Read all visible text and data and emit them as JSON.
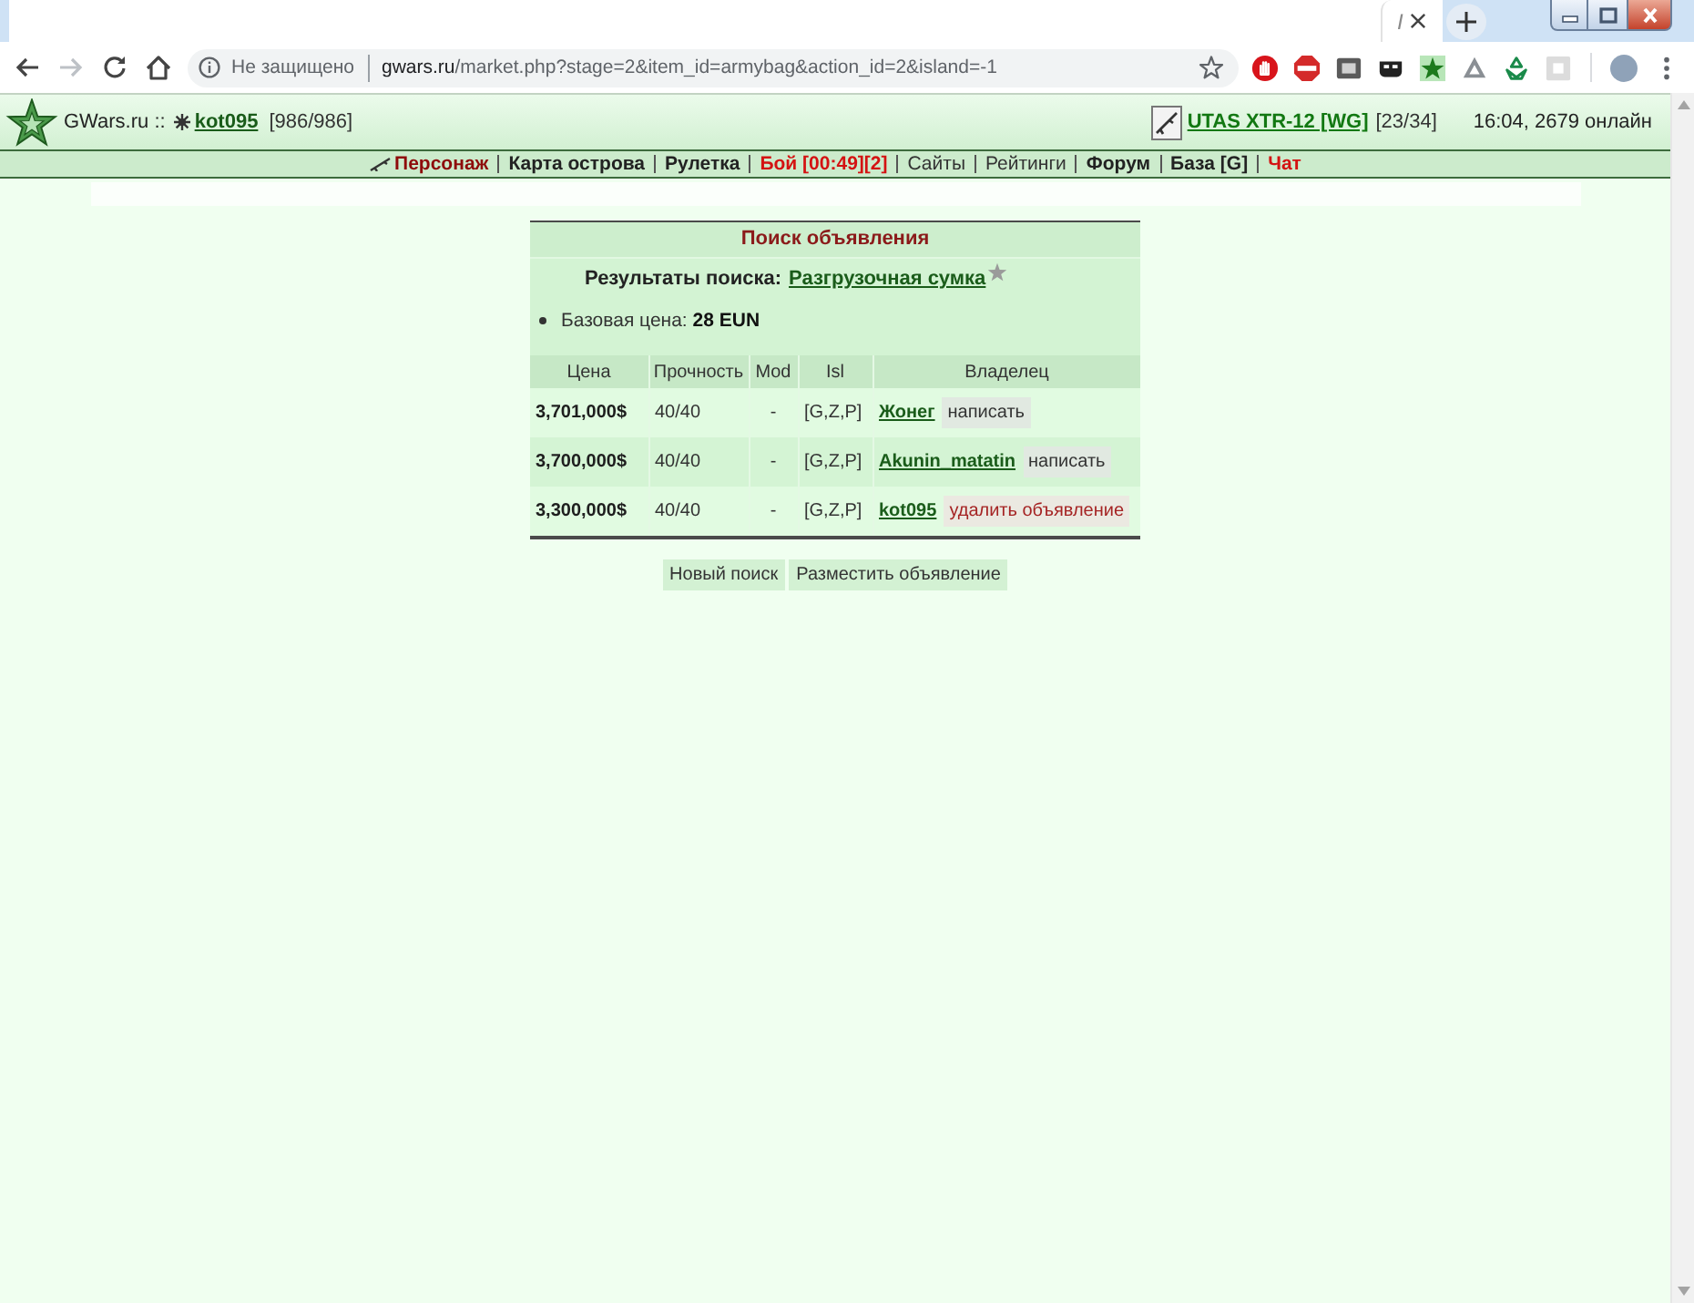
{
  "browser": {
    "tab": {
      "title": "I"
    },
    "address": {
      "security": "Не защищено",
      "host": "gwars.ru",
      "path": "/market.php?stage=2&item_id=armybag&action_id=2&island=-1"
    }
  },
  "header": {
    "site": "GWars.ru ::",
    "user": "kot095",
    "hp": "[986/986]",
    "weapon": "UTAS XTR-12 [WG]",
    "ammo": "[23/34]",
    "status": "16:04, 2679 онлайн"
  },
  "nav": [
    {
      "label": "Персонаж",
      "kind": "accent"
    },
    {
      "label": "Карта острова",
      "kind": "bold"
    },
    {
      "label": "Рулетка",
      "kind": "bold"
    },
    {
      "label": "Бой [00:49][2]",
      "kind": "alert"
    },
    {
      "label": "Сайты",
      "kind": "plain"
    },
    {
      "label": "Рейтинги",
      "kind": "plain"
    },
    {
      "label": "Форум",
      "kind": "bold"
    },
    {
      "label": "База [G]",
      "kind": "bold"
    },
    {
      "label": "Чат",
      "kind": "alert"
    }
  ],
  "search": {
    "title": "Поиск объявления",
    "results_label": "Результаты поиска:",
    "item": "Разгрузочная сумка",
    "base_price": "Базовая цена: **28 EUN**",
    "columns": [
      "Цена",
      "Прочность",
      "Mod",
      "Isl",
      "Владелец"
    ],
    "rows": [
      {
        "price": "3,701,000$",
        "durability": "40/40",
        "mod": "-",
        "islands": "[G,Z,P]",
        "owner": "Жонег",
        "action": {
          "label": "написать",
          "kind": "message"
        }
      },
      {
        "price": "3,700,000$",
        "durability": "40/40",
        "mod": "-",
        "islands": "[G,Z,P]",
        "owner": "Akunin_matatin",
        "action": {
          "label": "написать",
          "kind": "message"
        }
      },
      {
        "price": "3,300,000$",
        "durability": "40/40",
        "mod": "-",
        "islands": "[G,Z,P]",
        "owner": "kot095",
        "action": {
          "label": "удалить объявление",
          "kind": "delete"
        }
      }
    ]
  },
  "buttons": [
    "Новый поиск",
    "Разместить объявление"
  ]
}
